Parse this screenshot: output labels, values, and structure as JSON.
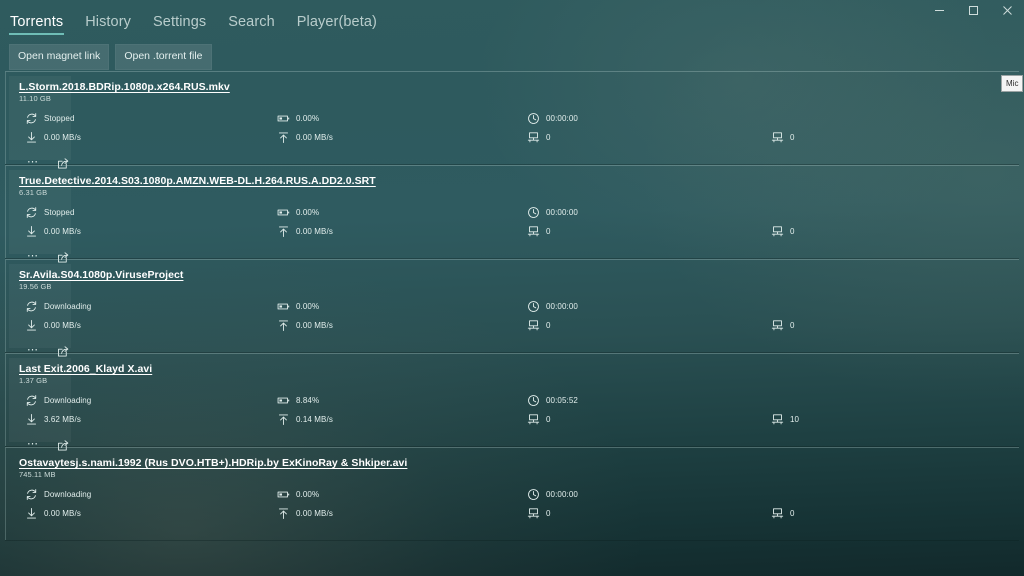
{
  "window": {
    "controls": [
      {
        "name": "minimize",
        "glyph": "minimize-icon"
      },
      {
        "name": "maximize",
        "glyph": "maximize-icon"
      },
      {
        "name": "close",
        "glyph": "close-icon"
      }
    ]
  },
  "nav": {
    "tabs": [
      {
        "label": "Torrents",
        "active": true
      },
      {
        "label": "History",
        "active": false
      },
      {
        "label": "Settings",
        "active": false
      },
      {
        "label": "Search",
        "active": false
      },
      {
        "label": "Player(beta)",
        "active": false
      }
    ]
  },
  "toolbar": {
    "open_magnet_label": "Open magnet link",
    "open_torrent_label": "Open .torrent file"
  },
  "tooltip": {
    "text": "Mic"
  },
  "colors": {
    "accent": "#6fbdb6",
    "background_top": "#2f5b5e",
    "background_bottom": "#12292b",
    "text_primary": "#ffffff",
    "text_secondary": "#cddcda"
  },
  "torrents": [
    {
      "name": "L.Storm.2018.BDRip.1080p.x264.RUS.mkv",
      "size": "11.10 GB",
      "status": "Stopped",
      "progress": "0.00%",
      "download_speed": "0.00 MB/s",
      "upload_speed": "0.00 MB/s",
      "elapsed": "00:00:00",
      "seeds": "0",
      "peers": "0",
      "has_actions": true
    },
    {
      "name": "True.Detective.2014.S03.1080p.AMZN.WEB-DL.H.264.RUS.A.DD2.0.SRT",
      "size": "6.31 GB",
      "status": "Stopped",
      "progress": "0.00%",
      "download_speed": "0.00 MB/s",
      "upload_speed": "0.00 MB/s",
      "elapsed": "00:00:00",
      "seeds": "0",
      "peers": "0",
      "has_actions": true
    },
    {
      "name": "Sr.Avila.S04.1080p.ViruseProject",
      "size": "19.56 GB",
      "status": "Downloading",
      "progress": "0.00%",
      "download_speed": "0.00 MB/s",
      "upload_speed": "0.00 MB/s",
      "elapsed": "00:00:00",
      "seeds": "0",
      "peers": "0",
      "has_actions": true
    },
    {
      "name": "Last Exit.2006_Klayd X.avi",
      "size": "1.37 GB",
      "status": "Downloading",
      "progress": "8.84%",
      "download_speed": "3.62 MB/s",
      "upload_speed": "0.14 MB/s",
      "elapsed": "00:05:52",
      "seeds": "0",
      "peers": "10",
      "has_actions": true
    },
    {
      "name": "Ostavaytesj.s.nami.1992 (Rus DVO.HTB+).HDRip.by ExKinoRay & Shkiper.avi",
      "size": "745.11 MB",
      "status": "Downloading",
      "progress": "0.00%",
      "download_speed": "0.00 MB/s",
      "upload_speed": "0.00 MB/s",
      "elapsed": "00:00:00",
      "seeds": "0",
      "peers": "0",
      "has_actions": false
    }
  ]
}
